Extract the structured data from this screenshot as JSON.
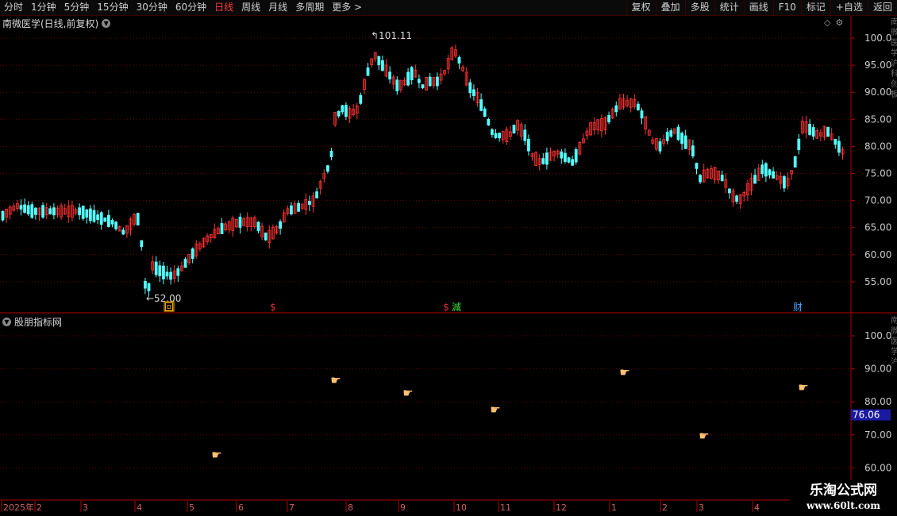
{
  "toolbar": {
    "periods": [
      "分时",
      "1分钟",
      "5分钟",
      "15分钟",
      "30分钟",
      "60分钟",
      "日线",
      "周线",
      "月线",
      "多周期",
      "更多 >"
    ],
    "active_period": "日线",
    "buttons": [
      "复权",
      "叠加",
      "多股",
      "统计",
      "画线",
      "F10",
      "标记",
      "+自选",
      "返回"
    ]
  },
  "main_chart": {
    "title": "南微医学(日线,前复权)",
    "y_ticks": [
      "100.0",
      "95.00",
      "90.00",
      "85.00",
      "80.00",
      "75.00",
      "70.00",
      "65.00",
      "60.00",
      "55.00"
    ],
    "high_label": "101.11",
    "low_label": "52.00",
    "event_markers": [
      {
        "text": "回",
        "color": "#ffb000",
        "month": "4"
      },
      {
        "text": "$",
        "color": "#e03030",
        "month": "6"
      },
      {
        "text": "$",
        "color": "#e03030",
        "month": "9"
      },
      {
        "text": "減",
        "color": "#40e040",
        "month": "9"
      },
      {
        "text": "财",
        "color": "#4aa0ff",
        "month": "3"
      }
    ],
    "colors": {
      "up": "#ff3232",
      "down": "#54ffff",
      "grid": "#5a0000",
      "axis": "#b00000"
    }
  },
  "sub_chart": {
    "title": "股朋指标网",
    "y_ticks": [
      "100.0",
      "90.00",
      "80.00",
      "70.00",
      "60.00"
    ],
    "current_value": "76.06",
    "hand_icon": "pointing-hand-icon"
  },
  "x_axis": {
    "labels": [
      "2025年",
      "2",
      "3",
      "4",
      "5",
      "6",
      "7",
      "8",
      "9",
      "10",
      "11",
      "12",
      "1",
      "2",
      "3",
      "4"
    ]
  },
  "watermark": {
    "line1": "乐淘公式网",
    "line2": "www.60lt.com"
  },
  "right_strip_text": "南微医学沪科创板"
}
